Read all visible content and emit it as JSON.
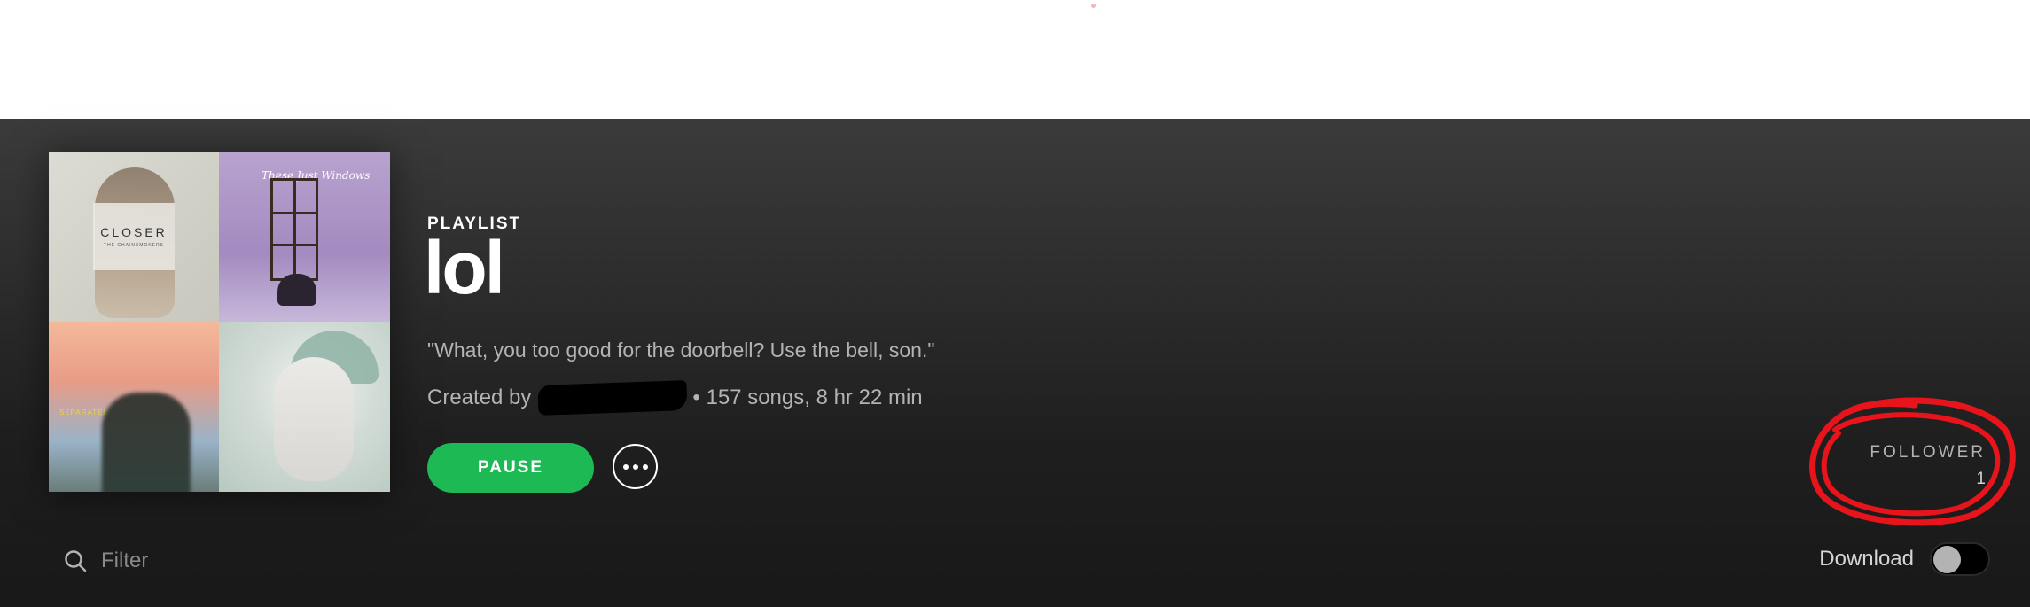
{
  "playlist": {
    "type_label": "PLAYLIST",
    "title": "lol",
    "description": "\"What, you too good for the doorbell? Use the bell, son.\"",
    "created_by_prefix": "Created by",
    "stats": "• 157 songs, 8 hr 22 min"
  },
  "cover": {
    "tile1_title": "CLOSER",
    "tile1_sub": "THE CHAINSMOKERS",
    "tile2_title": "These Just Windows",
    "tile3_title": "SEPARATED FOR YOU"
  },
  "actions": {
    "pause_label": "PAUSE",
    "more_icon": "more-options-icon"
  },
  "followers": {
    "label": "FOLLOWER",
    "count": "1"
  },
  "filter": {
    "placeholder": "Filter"
  },
  "download": {
    "label": "Download",
    "enabled": false
  },
  "colors": {
    "accent_green": "#1db954",
    "annotation_red": "#e8141c",
    "header_bg": "#2c2c2c"
  }
}
